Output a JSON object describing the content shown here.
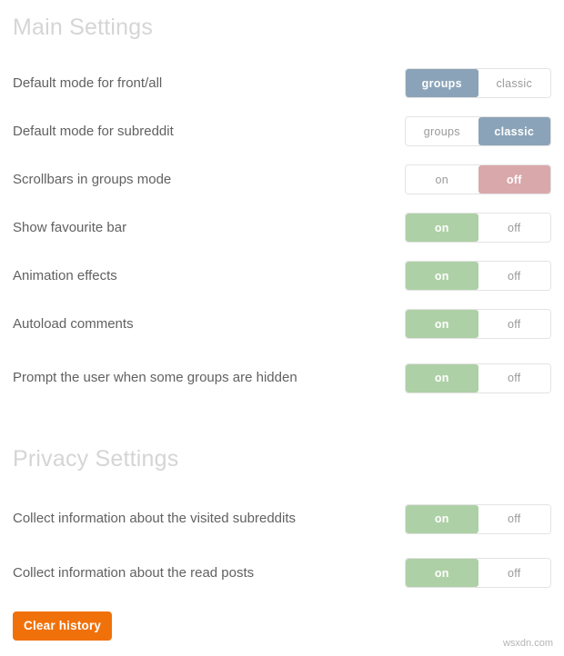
{
  "sections": [
    {
      "id": "main",
      "title": "Main Settings",
      "rows": [
        {
          "label": "Default mode for front/all",
          "options": [
            {
              "label": "groups",
              "active": true,
              "tone": "blue"
            },
            {
              "label": "classic",
              "active": false,
              "tone": "blue"
            }
          ]
        },
        {
          "label": "Default mode for subreddit",
          "options": [
            {
              "label": "groups",
              "active": false,
              "tone": "blue"
            },
            {
              "label": "classic",
              "active": true,
              "tone": "blue"
            }
          ]
        },
        {
          "label": "Scrollbars in groups mode",
          "options": [
            {
              "label": "on",
              "active": false,
              "tone": "green"
            },
            {
              "label": "off",
              "active": true,
              "tone": "pink"
            }
          ]
        },
        {
          "label": "Show favourite bar",
          "options": [
            {
              "label": "on",
              "active": true,
              "tone": "green"
            },
            {
              "label": "off",
              "active": false,
              "tone": "pink"
            }
          ]
        },
        {
          "label": "Animation effects",
          "options": [
            {
              "label": "on",
              "active": true,
              "tone": "green"
            },
            {
              "label": "off",
              "active": false,
              "tone": "pink"
            }
          ]
        },
        {
          "label": "Autoload comments",
          "options": [
            {
              "label": "on",
              "active": true,
              "tone": "green"
            },
            {
              "label": "off",
              "active": false,
              "tone": "pink"
            }
          ]
        },
        {
          "label": "Prompt the user when some groups are hidden",
          "tall": true,
          "options": [
            {
              "label": "on",
              "active": true,
              "tone": "green"
            },
            {
              "label": "off",
              "active": false,
              "tone": "pink"
            }
          ]
        }
      ]
    },
    {
      "id": "privacy",
      "title": "Privacy Settings",
      "rows": [
        {
          "label": "Collect information about the visited subreddits",
          "tall": true,
          "options": [
            {
              "label": "on",
              "active": true,
              "tone": "green"
            },
            {
              "label": "off",
              "active": false,
              "tone": "pink"
            }
          ]
        },
        {
          "label": "Collect information about the read posts",
          "options": [
            {
              "label": "on",
              "active": true,
              "tone": "green"
            },
            {
              "label": "off",
              "active": false,
              "tone": "pink"
            }
          ]
        }
      ]
    }
  ],
  "actions": {
    "clear_history_label": "Clear history"
  },
  "watermark": "wsxdn.com",
  "colors": {
    "accent_blue": "#8ba3b8",
    "accent_green": "#aed0a6",
    "accent_pink": "#d9a8ab",
    "accent_orange": "#f0710a",
    "heading": "#d5d5d5",
    "label": "#616161"
  }
}
